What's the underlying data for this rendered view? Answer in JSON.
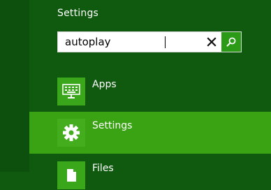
{
  "panel": {
    "title": "Settings"
  },
  "search": {
    "value": "autoplay"
  },
  "results": {
    "apps": {
      "label": "Apps",
      "icon": "keyboard-icon"
    },
    "settings": {
      "label": "Settings",
      "icon": "gear-icon"
    },
    "files": {
      "label": "Files",
      "icon": "document-icon"
    }
  },
  "colors": {
    "background": "#0f5a0f",
    "highlight": "#39a314",
    "tile": "#3aa61a",
    "search_button": "#2b9a16"
  }
}
